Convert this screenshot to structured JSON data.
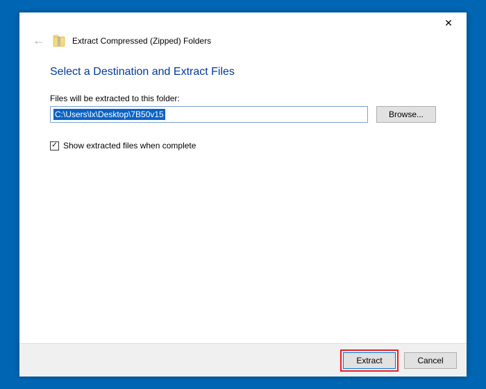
{
  "window": {
    "title": "Extract Compressed (Zipped) Folders"
  },
  "heading": "Select a Destination and Extract Files",
  "labels": {
    "destination": "Files will be extracted to this folder:",
    "showFiles": "Show extracted files when complete"
  },
  "fields": {
    "path": "C:\\Users\\lx\\Desktop\\7B50v15"
  },
  "buttons": {
    "browse": "Browse...",
    "extract": "Extract",
    "cancel": "Cancel"
  },
  "checkbox": {
    "showFilesChecked": true
  }
}
